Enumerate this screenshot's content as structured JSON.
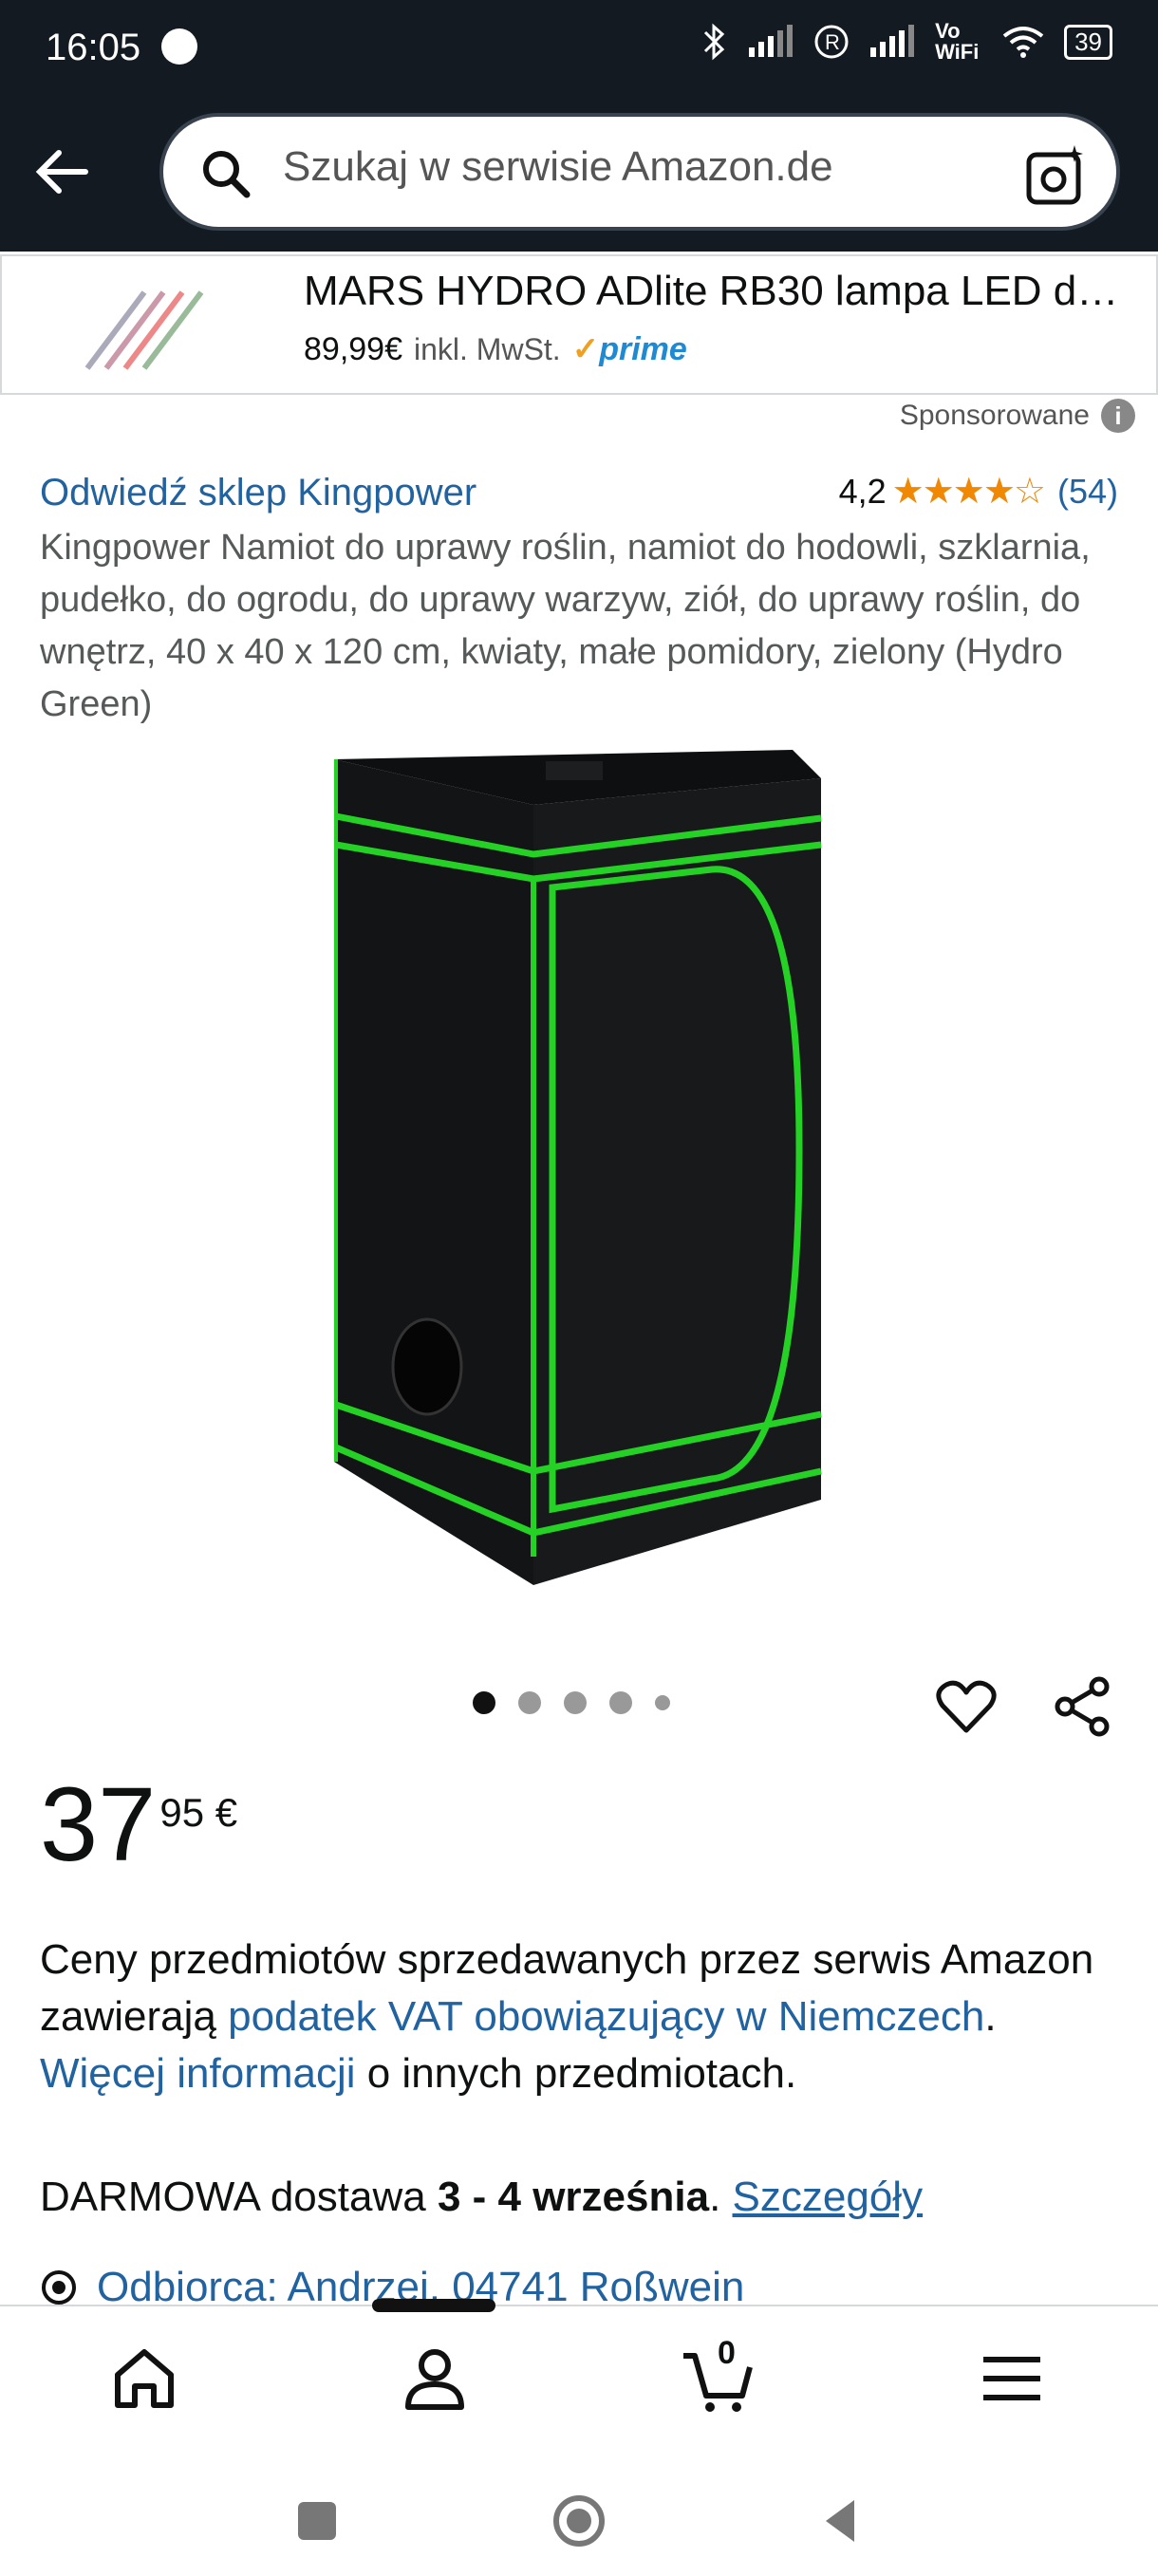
{
  "status_bar": {
    "time": "16:05",
    "network": "Vo WiFi",
    "battery": "39"
  },
  "search": {
    "placeholder": "Szukaj w serwisie Amazon.de"
  },
  "ad": {
    "title": "MARS HYDRO ADlite RB30 lampa LED do…",
    "price": "89,99€",
    "vat": "inkl. MwSt.",
    "prime": "prime"
  },
  "sponsored": {
    "label": "Sponsorowane",
    "info": "i"
  },
  "product": {
    "store": "Odwiedź sklep Kingpower",
    "rating": "4,2",
    "rating_stars": 4.2,
    "rating_count": "(54)",
    "title": "Kingpower Namiot do uprawy roślin, namiot do hodowli, szklarnia, pudełko, do ogrodu, do uprawy warzyw, ziół, do uprawy roślin, do wnętrz, 40 x 40 x 120 cm, kwiaty, małe pomidory, zielony (Hydro Green)"
  },
  "gallery": {
    "count": 5,
    "active": 0
  },
  "price": {
    "whole": "37",
    "fraction": "95 €"
  },
  "vat": {
    "part1": "Ceny przedmiotów sprzedawanych przez serwis Amazon zawierają ",
    "link1": "podatek VAT obowiązujący w Niemczech",
    "part2": ". ",
    "link2": "Więcej informacji",
    "part3": " o innych przedmiotach."
  },
  "delivery": {
    "prefix": "DARMOWA dostawa ",
    "dates": "3 - 4 września",
    "suffix": ". ",
    "details": "Szczegóły"
  },
  "recipient": {
    "text": "Odbiorca: Andrzej, 04741 Roßwein"
  },
  "nav": {
    "cart_count": "0"
  },
  "colors": {
    "header": "#131a22",
    "link": "#2162a1",
    "star": "#f08804",
    "prime": "#1f8ad2"
  }
}
